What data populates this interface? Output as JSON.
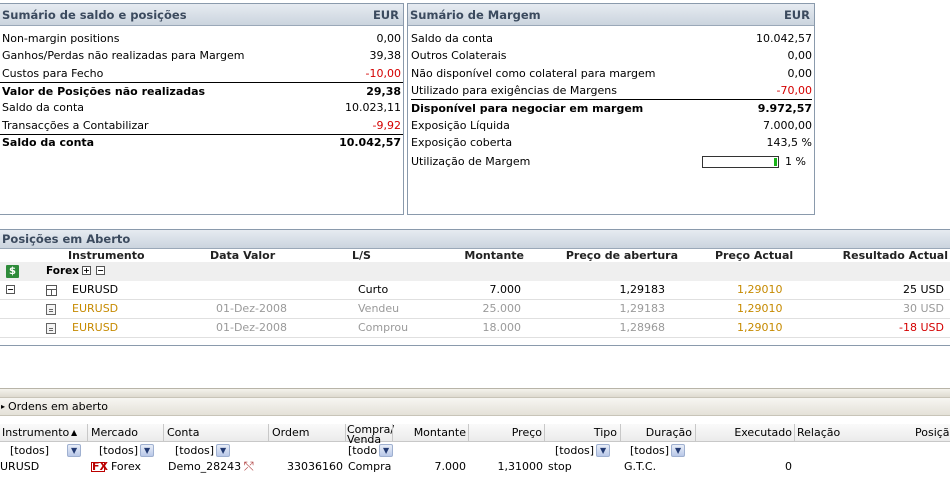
{
  "saldo": {
    "title": "Sumário de saldo e posições",
    "currency": "EUR",
    "rows": [
      {
        "label": "Non-margin positions",
        "value": "0,00"
      },
      {
        "label": "Ganhos/Perdas não realizadas para Margem",
        "value": "39,38"
      },
      {
        "label": "Custos para Fecho",
        "value": "-10,00"
      },
      {
        "label": "Valor de Posições não realizadas",
        "value": "29,38"
      },
      {
        "label": "Saldo da conta",
        "value": "10.023,11"
      },
      {
        "label": "Transacções a Contabilizar",
        "value": "-9,92"
      },
      {
        "label": "Saldo da conta",
        "value": "10.042,57"
      }
    ]
  },
  "margem": {
    "title": "Sumário de Margem",
    "currency": "EUR",
    "rows": [
      {
        "label": "Saldo da conta",
        "value": "10.042,57"
      },
      {
        "label": "Outros Colaterais",
        "value": "0,00"
      },
      {
        "label": "Não disponível como colateral para margem",
        "value": "0,00"
      },
      {
        "label": "Utilizado para exigências de Margens",
        "value": "-70,00"
      },
      {
        "label": "Disponível para negociar em margem",
        "value": "9.972,57"
      },
      {
        "label": "Exposição Líquida",
        "value": "7.000,00"
      },
      {
        "label": "Exposição coberta",
        "value": "143,5 %"
      }
    ],
    "utilizacao": {
      "label": "Utilização de Margem",
      "value": "1 %",
      "fraction": 0.01
    }
  },
  "posicoes": {
    "title": "Posições em Aberto",
    "columns": {
      "instrumento": "Instrumento",
      "data_valor": "Data Valor",
      "ls": "L/S",
      "montante": "Montante",
      "preco_abertura": "Preço de abertura",
      "preco_actual": "Preço Actual",
      "resultado": "Resultado Actual"
    },
    "group_label": "Forex",
    "rows": [
      {
        "instrumento": "EURUSD",
        "data": "",
        "ls": "Curto",
        "montante": "7.000",
        "abertura": "1,29183",
        "actual": "1,29010",
        "resultado": "25 USD"
      },
      {
        "instrumento": "EURUSD",
        "data": "01-Dez-2008",
        "ls": "Vendeu",
        "montante": "25.000",
        "abertura": "1,29183",
        "actual": "1,29010",
        "resultado": "30 USD"
      },
      {
        "instrumento": "EURUSD",
        "data": "01-Dez-2008",
        "ls": "Comprou",
        "montante": "18.000",
        "abertura": "1,28968",
        "actual": "1,29010",
        "resultado": "-18 USD"
      }
    ]
  },
  "ordens": {
    "title": "Ordens em aberto",
    "columns": {
      "instrumento": "Instrumento",
      "sort_arrow": "▲",
      "mercado": "Mercado",
      "conta": "Conta",
      "ordem": "Ordem",
      "compra_venda_1": "Compra/",
      "compra_venda_2": "Venda",
      "montante": "Montante",
      "preco": "Preço",
      "tipo": "Tipo",
      "duracao": "Duração",
      "executado": "Executado",
      "relacao": "Relação",
      "posicao": "Posiçã"
    },
    "filters": {
      "instrumento": "[todos]",
      "mercado": "[todos]",
      "conta": "[todos]",
      "compra_venda": "[todo",
      "tipo": "[todos]",
      "duracao": "[todos]"
    },
    "row": {
      "instrumento": "URUSD",
      "mercado": "Forex",
      "conta": "Demo_28243",
      "ordem": "33036160",
      "compra_venda": "Compra",
      "montante": "7.000",
      "preco": "1,31000",
      "tipo": "stop",
      "duracao": "G.T.C.",
      "executado": "0"
    }
  },
  "colors": {
    "negative": "#d40000",
    "price_actual": "#c68a00",
    "bar_fill": "#1ab31a"
  }
}
